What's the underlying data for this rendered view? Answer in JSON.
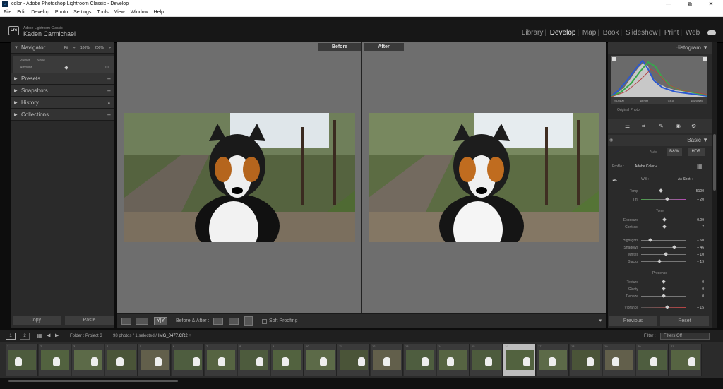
{
  "window": {
    "title": "color - Adobe Photoshop Lightroom Classic - Develop",
    "controls": [
      "—",
      "⧉",
      "✕"
    ]
  },
  "menu": [
    "File",
    "Edit",
    "Develop",
    "Photo",
    "Settings",
    "Tools",
    "View",
    "Window",
    "Help"
  ],
  "identity": {
    "logo": "Lrc",
    "app_name": "Adobe Lightroom Classic",
    "user": "Kaden Carmichael"
  },
  "modules": [
    "Library",
    "Develop",
    "Map",
    "Book",
    "Slideshow",
    "Print",
    "Web"
  ],
  "active_module": "Develop",
  "left_panel": {
    "navigator": {
      "label": "Navigator",
      "options": [
        "Fit ÷",
        "100%",
        "200% ÷"
      ]
    },
    "navpreset": {
      "preset_label": "Preset",
      "preset_value": "None",
      "amount_label": "Amount",
      "amount_value": "100"
    },
    "sections": [
      "Presets",
      "Snapshots",
      "History",
      "Collections"
    ],
    "copy": "Copy...",
    "paste": "Paste"
  },
  "compare": {
    "before": "Before",
    "after": "After"
  },
  "toolbar": {
    "yy": "Y|Y",
    "before_after": "Before & After :",
    "soft_proofing": "Soft Proofing"
  },
  "right_panel": {
    "histogram_label": "Histogram",
    "camera": [
      "ISO 400",
      "18 mm",
      "f / 8.0",
      "1/320 sec"
    ],
    "original_photo": "Original Photo",
    "basic_label": "Basic",
    "treatment": [
      "Auto",
      "B&W",
      "HDR"
    ],
    "profile_label": "Profile :",
    "profile_value": "Adobe Color ÷",
    "wb_label": "WB :",
    "wb_value": "As Shot ÷",
    "sliders_wb": [
      {
        "label": "Temp",
        "value": "5100",
        "pos": 0.43
      },
      {
        "label": "Tint",
        "value": "+ 20",
        "pos": 0.58
      }
    ],
    "tone_label": "Tone",
    "sliders_tone": [
      {
        "label": "Exposure",
        "value": "+ 0.09",
        "pos": 0.51
      },
      {
        "label": "Contrast",
        "value": "+ 7",
        "pos": 0.52
      }
    ],
    "sliders_tone2": [
      {
        "label": "Highlights",
        "value": "− 60",
        "pos": 0.2
      },
      {
        "label": "Shadows",
        "value": "+ 46",
        "pos": 0.73
      },
      {
        "label": "Whites",
        "value": "+ 10",
        "pos": 0.55
      },
      {
        "label": "Blacks",
        "value": "− 19",
        "pos": 0.4
      }
    ],
    "presence_label": "Presence",
    "sliders_presence": [
      {
        "label": "Texture",
        "value": "0",
        "pos": 0.5
      },
      {
        "label": "Clarity",
        "value": "0",
        "pos": 0.5
      },
      {
        "label": "Dehaze",
        "value": "0",
        "pos": 0.5
      },
      {
        "label": "Vibrance",
        "value": "+ 15",
        "pos": 0.58
      }
    ],
    "previous": "Previous",
    "reset": "Reset"
  },
  "filmstrip_bar": {
    "folder": "Folder : Project 3",
    "count": "98 photos / 1 selected /",
    "filename": "IMG_0477.CR2 ÷",
    "filter_label": "Filter :",
    "filter_value": "Filters Off"
  },
  "filmstrip": {
    "numbers": [
      "1",
      "2",
      "3",
      "4",
      "5",
      "6",
      "7",
      "8",
      "9",
      "10",
      "11",
      "12",
      "13",
      "14",
      "15",
      "16",
      "17",
      "18",
      "19",
      "20",
      "21"
    ],
    "selected_index": 15
  }
}
